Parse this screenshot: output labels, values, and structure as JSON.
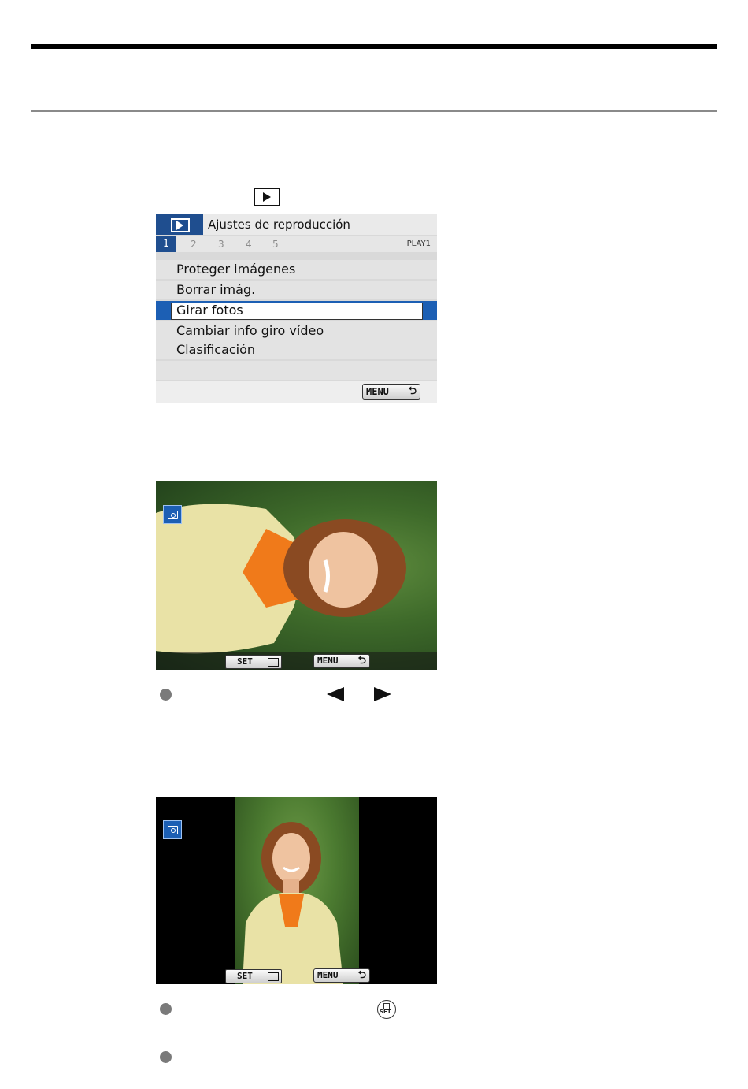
{
  "icons": {
    "playback": "playback-icon",
    "rotate": "rotate-icon",
    "set_dial": "set-dial-icon",
    "left_arrow": "left-arrow-icon",
    "right_arrow": "right-arrow-icon",
    "return": "return-icon"
  },
  "colors": {
    "menu_accent": "#1f4e8f",
    "selection": "#1c5fb4"
  },
  "menu": {
    "title": "Ajustes de reproducción",
    "tab_numbers": [
      "1",
      "2",
      "3",
      "4",
      "5"
    ],
    "tab_label": "PLAY1",
    "items": [
      "Proteger imágenes",
      "Borrar imág.",
      "Girar fotos",
      "Cambiar info giro vídeo",
      "Clasificación"
    ],
    "selected_index": 2,
    "menu_button": "MENU",
    "return_glyph": "⮌"
  },
  "photo_screen": {
    "set_button": "SET",
    "menu_button": "MENU",
    "return_glyph": "⮌"
  }
}
